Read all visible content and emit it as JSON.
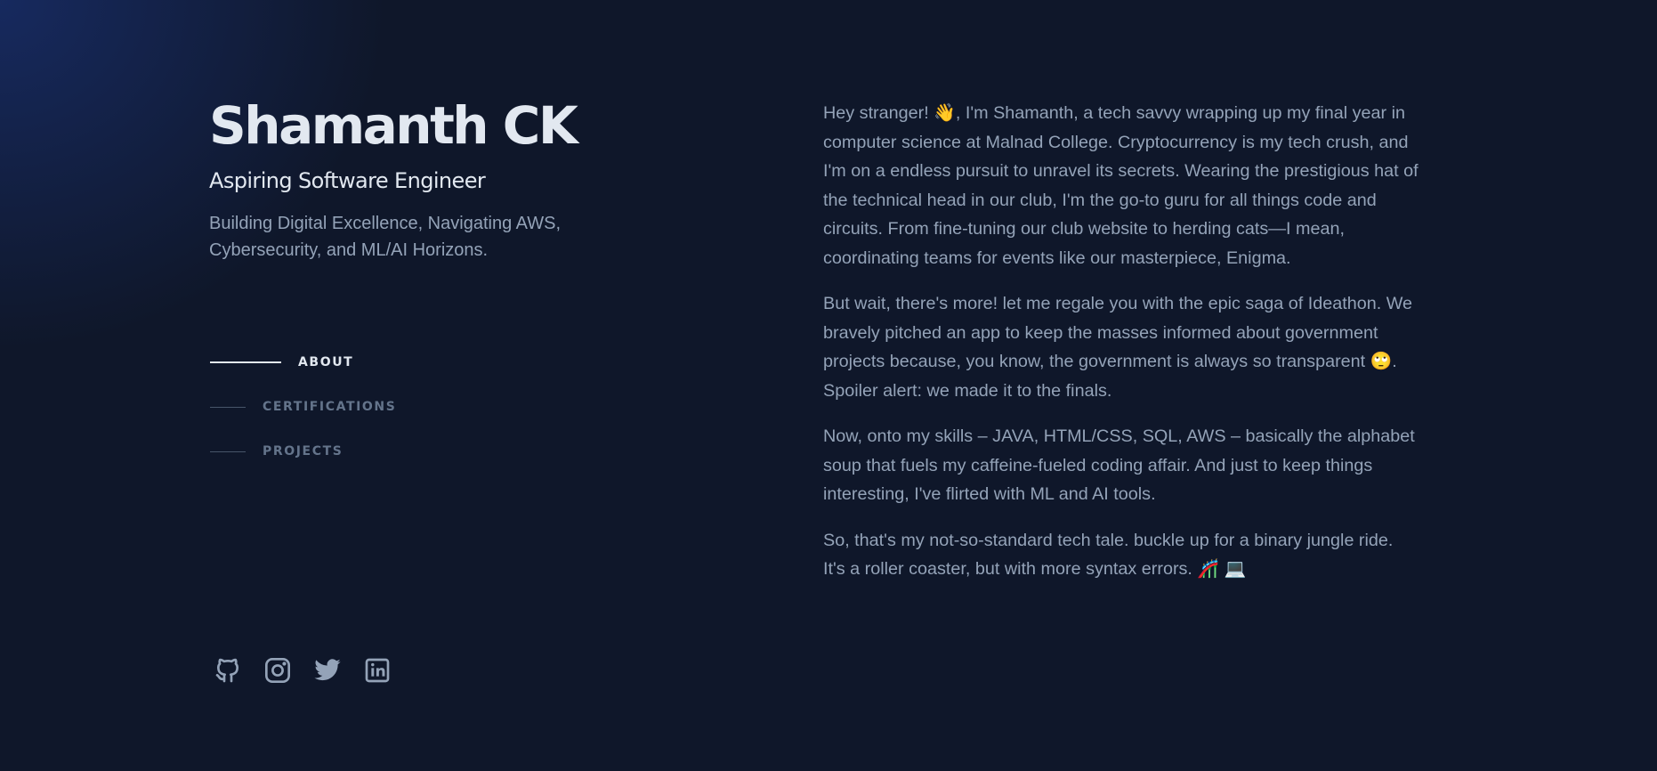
{
  "header": {
    "name": "Shamanth CK",
    "role": "Aspiring Software Engineer",
    "tagline": "Building Digital Excellence, Navigating AWS, Cybersecurity, and ML/AI Horizons."
  },
  "nav": {
    "items": [
      {
        "label": "ABOUT",
        "active": true
      },
      {
        "label": "CERTIFICATIONS",
        "active": false
      },
      {
        "label": "PROJECTS",
        "active": false
      }
    ]
  },
  "socials": [
    {
      "icon": "github-icon"
    },
    {
      "icon": "instagram-icon"
    },
    {
      "icon": "twitter-icon"
    },
    {
      "icon": "linkedin-icon"
    }
  ],
  "about": {
    "paragraphs": [
      "Hey stranger! 👋, I'm Shamanth, a tech savvy wrapping up my final year in computer science at Malnad College. Cryptocurrency is my tech crush, and I'm on a endless pursuit to unravel its secrets. Wearing the prestigious hat of the technical head in our club, I'm the go-to guru for all things code and circuits. From fine-tuning our club website to herding cats—I mean, coordinating teams for events like our masterpiece, Enigma.",
      "But wait, there's more! let me regale you with the epic saga of Ideathon. We bravely pitched an app to keep the masses informed about government projects because, you know, the government is always so transparent 🙄. Spoiler alert: we made it to the finals.",
      "Now, onto my skills – JAVA, HTML/CSS, SQL, AWS – basically the alphabet soup that fuels my caffeine-fueled coding affair. And just to keep things interesting, I've flirted with ML and AI tools.",
      "So, that's my not-so-standard tech tale. buckle up for a binary jungle ride. It's a roller coaster, but with more syntax errors. 🎢 💻"
    ]
  },
  "colors": {
    "background": "#0f172a",
    "heading": "#e2e8f0",
    "body_text": "#94a3b8",
    "nav_inactive": "#64748b",
    "nav_line_inactive": "#475569",
    "glow": "#1d398a"
  }
}
